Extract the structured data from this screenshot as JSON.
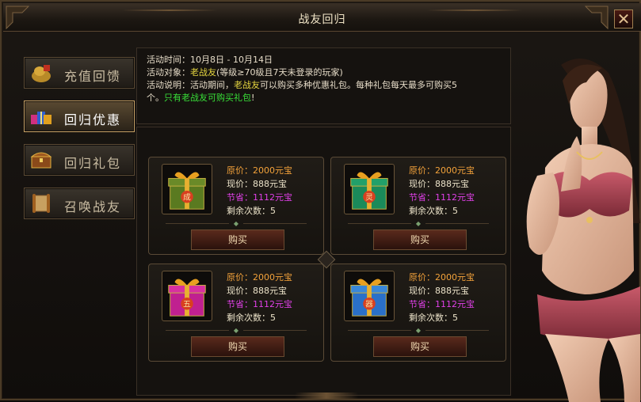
{
  "window": {
    "title": "战友回归",
    "close_label": "✕"
  },
  "sidebar": {
    "items": [
      {
        "label": "充值回馈",
        "icon": "gift-sack-icon",
        "active": false
      },
      {
        "label": "回归优惠",
        "icon": "gift-boxes-icon",
        "active": true
      },
      {
        "label": "回归礼包",
        "icon": "treasure-chest-icon",
        "active": false
      },
      {
        "label": "召唤战友",
        "icon": "scroll-icon",
        "active": false
      }
    ]
  },
  "info": {
    "time_label": "活动时间：",
    "time_value": "10月8日 - 10月14日",
    "target_label": "活动对象：",
    "target_highlight": "老战友",
    "target_rest": "(等级≥70级且7天未登录的玩家)",
    "desc_label": "活动说明：",
    "desc_part1": "活动期间，",
    "desc_highlight": "老战友",
    "desc_part2": "可以购买多种优惠礼包。每种礼包每天最多可购买5",
    "desc_part3": "个。",
    "desc_notice": "只有老战友可购买礼包",
    "desc_bang": "!"
  },
  "cards": [
    {
      "gift_icon": "green-gift-box-icon",
      "emblem": "成",
      "original_price": "原价：2000元宝",
      "current_price": "现价：888元宝",
      "savings": "节省：1112元宝",
      "remaining": "剩余次数：5",
      "buy_label": "购买"
    },
    {
      "gift_icon": "teal-gift-box-icon",
      "emblem": "灵",
      "original_price": "原价：2000元宝",
      "current_price": "现价：888元宝",
      "savings": "节省：1112元宝",
      "remaining": "剩余次数：5",
      "buy_label": "购买"
    },
    {
      "gift_icon": "magenta-gift-box-icon",
      "emblem": "五",
      "original_price": "原价：2000元宝",
      "current_price": "现价：888元宝",
      "savings": "节省：1112元宝",
      "remaining": "剩余次数：5",
      "buy_label": "购买"
    },
    {
      "gift_icon": "blue-gift-box-icon",
      "emblem": "器",
      "original_price": "原价：2000元宝",
      "current_price": "现价：888元宝",
      "savings": "节省：1112元宝",
      "remaining": "剩余次数：5",
      "buy_label": "购买"
    }
  ],
  "colors": {
    "accent_gold": "#c8a266",
    "highlight_green": "#38e038",
    "price_orange": "#f3a23a",
    "savings_magenta": "#e040e8"
  }
}
